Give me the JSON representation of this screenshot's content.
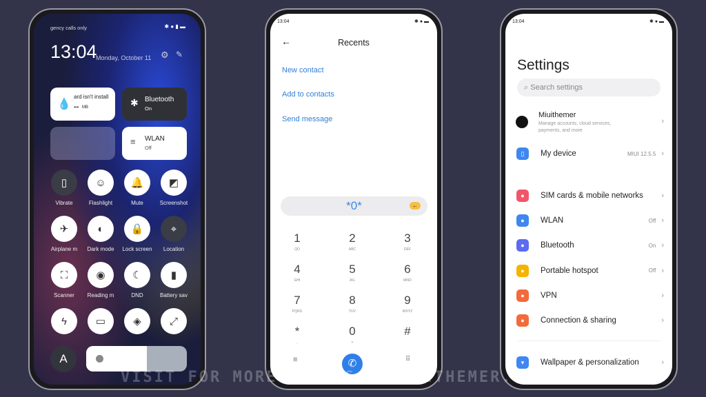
{
  "control_center": {
    "status": "gency calls only",
    "time": "13:04",
    "date": "Monday, October 11",
    "tiles": [
      {
        "title": "ard isn't install",
        "sub": "--",
        "unit": "MB"
      },
      {
        "title": "Bluetooth",
        "sub": "On"
      },
      {
        "title": "WLAN",
        "sub": "Off"
      }
    ],
    "toggles": [
      "Vibrate",
      "Flashlight",
      "Mute",
      "Screenshot",
      "Airplane m",
      "Dark mode",
      "Lock screen",
      "Location",
      "Scanner",
      "Reading m",
      "DND",
      "Battery sav",
      "",
      "",
      "",
      ""
    ],
    "toggle_icons": [
      "vibrate-icon",
      "flashlight-icon",
      "mute-icon",
      "screenshot-icon",
      "airplane-icon",
      "dark-mode-icon",
      "lock-screen-icon",
      "location-icon",
      "scanner-icon",
      "reading-mode-icon",
      "dnd-icon",
      "battery-saver-icon",
      "power-icon",
      "cast-icon",
      "nearby-share-icon",
      "resize-icon"
    ],
    "auto_brightness": "A",
    "brightness": 0.6
  },
  "dialer": {
    "status": "13:04",
    "title": "Recents",
    "links": [
      "New contact",
      "Add to contacts",
      "Send message"
    ],
    "input": "*0*",
    "keys": [
      [
        "1",
        "QO"
      ],
      [
        "2",
        "ABC"
      ],
      [
        "3",
        "DEF"
      ],
      [
        "4",
        "GHI"
      ],
      [
        "5",
        "JKL"
      ],
      [
        "6",
        "MNO"
      ],
      [
        "7",
        "PQRS"
      ],
      [
        "8",
        "TUV"
      ],
      [
        "9",
        "WXYZ"
      ],
      [
        "*",
        ","
      ],
      [
        "0",
        "+"
      ],
      [
        "#",
        ""
      ]
    ],
    "accent": "#2f7fd8"
  },
  "settings": {
    "status": "13:04",
    "title": "Settings",
    "search_placeholder": "Search settings",
    "account": {
      "name": "Miuithemer",
      "sub": "Manage accounts, cloud services, payments, and more"
    },
    "device": {
      "label": "My device",
      "value": "MIUI 12.5.5"
    },
    "items": [
      {
        "label": "SIM cards & mobile networks",
        "value": "",
        "color": "#f0566a"
      },
      {
        "label": "WLAN",
        "value": "Off",
        "color": "#3f86f0"
      },
      {
        "label": "Bluetooth",
        "value": "On",
        "color": "#5b6cf0"
      },
      {
        "label": "Portable hotspot",
        "value": "Off",
        "color": "#f4b400"
      },
      {
        "label": "VPN",
        "value": "",
        "color": "#f26a3c"
      },
      {
        "label": "Connection & sharing",
        "value": "",
        "color": "#f26a3c"
      }
    ],
    "wallpaper": {
      "label": "Wallpaper & personalization",
      "color": "#3f86f0"
    }
  },
  "watermark": "VISIT FOR MORE THEMES - MIUITHEMER.COM"
}
